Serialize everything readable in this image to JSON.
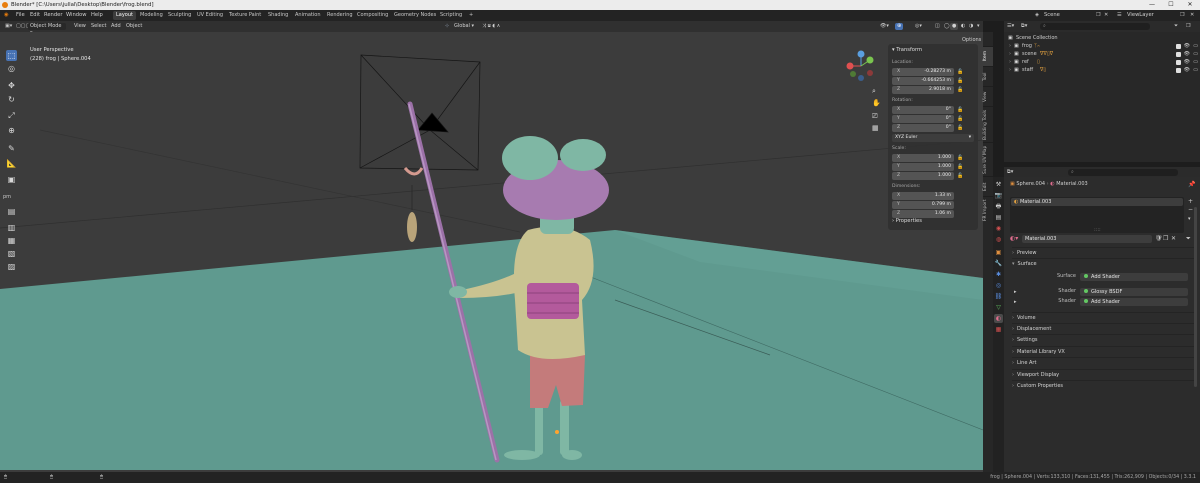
{
  "title_bar": {
    "title": "Blender* [C:\\Users\\jullal\\Desktop\\Blender\\frog.blend]",
    "minimize": "—",
    "maximize": "☐",
    "close": "✕"
  },
  "menu": {
    "items": [
      "File",
      "Edit",
      "Render",
      "Window",
      "Help"
    ]
  },
  "workspaces": {
    "tabs": [
      "Layout",
      "Modeling",
      "Sculpting",
      "UV Editing",
      "Texture Paint",
      "Shading",
      "Animation",
      "Rendering",
      "Compositing",
      "Geometry Nodes",
      "Scripting"
    ],
    "add": "+",
    "active": "Layout"
  },
  "top_right": {
    "scene": "Scene",
    "view_layer": "ViewLayer"
  },
  "viewport_header": {
    "mode": "Object Mode",
    "menus": [
      "View",
      "Select",
      "Add",
      "Object"
    ],
    "transform": "Global",
    "options": "Options"
  },
  "viewport": {
    "perspective": "User Perspective",
    "object": "(228) frog | Sphere.004"
  },
  "tool_group": "pm",
  "n_panel": {
    "transform_title": "Transform",
    "location_label": "Location:",
    "location": [
      {
        "axis": "X",
        "value": "-0.28273 m"
      },
      {
        "axis": "Y",
        "value": "-0.664253 m"
      },
      {
        "axis": "Z",
        "value": "2.9018 m"
      }
    ],
    "rotation_label": "Rotation:",
    "rotation": [
      {
        "axis": "X",
        "value": "0°"
      },
      {
        "axis": "Y",
        "value": "0°"
      },
      {
        "axis": "Z",
        "value": "0°"
      }
    ],
    "rotation_mode": "XYZ Euler",
    "scale_label": "Scale:",
    "scale": [
      {
        "axis": "X",
        "value": "1.000"
      },
      {
        "axis": "Y",
        "value": "1.000"
      },
      {
        "axis": "Z",
        "value": "1.000"
      }
    ],
    "dimensions_label": "Dimensions:",
    "dimensions": [
      {
        "axis": "X",
        "value": "1.33 m"
      },
      {
        "axis": "Y",
        "value": "0.799 m"
      },
      {
        "axis": "Z",
        "value": "1.06 m"
      }
    ],
    "properties_title": "Properties"
  },
  "n_tabs": [
    "Item",
    "Tool",
    "View",
    "Building Tools",
    "Sure UV Map",
    "Edit",
    "FR Import"
  ],
  "outliner": {
    "collection": "Scene Collection",
    "rows": [
      {
        "name": "frog"
      },
      {
        "name": "scene"
      },
      {
        "name": "ref"
      },
      {
        "name": "staff"
      }
    ]
  },
  "properties": {
    "object": "Sphere.004",
    "material_breadcrumb": "Material.003",
    "slot": "Material.003",
    "material_name": "Material.003",
    "sections_top": [
      "Preview",
      "Surface"
    ],
    "surface_rows": [
      {
        "label": "Surface",
        "value": "Add Shader",
        "dot": "green"
      },
      {
        "label": "Shader",
        "value": "Glossy BSDF",
        "dot": "green"
      },
      {
        "label": "Shader",
        "value": "Add Shader",
        "dot": "green"
      }
    ],
    "sections": [
      "Volume",
      "Displacement",
      "Settings",
      "Material Library VX",
      "Line Art",
      "Viewport Display",
      "Custom Properties"
    ]
  },
  "status": {
    "text": "frog | Sphere.004 | Verts:133,310 | Faces:131,455 | Tris:262,909 | Objects:0/34 | 3.3.1"
  },
  "colors": {
    "accent": "#4772b3",
    "floor": "#5f9a8f",
    "grid": "#404040",
    "skin": "#7fb7a4",
    "purple": "#a77bb0",
    "staff": "#9c71a8"
  }
}
